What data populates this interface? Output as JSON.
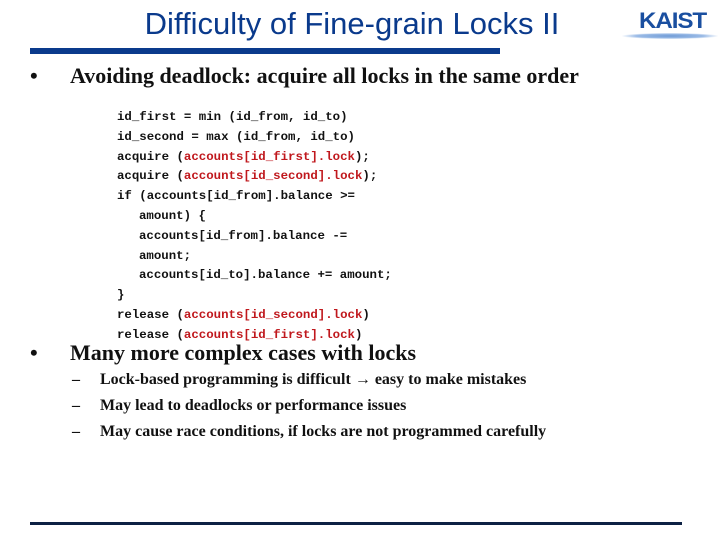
{
  "slide": {
    "title": "Difficulty of Fine-grain Locks II",
    "logo_text": "KAIST",
    "colors": {
      "title": "#0a3a8c",
      "rule": "#0a3a8c",
      "code_highlight": "#c0181d",
      "bottom_rule": "#0d2144"
    },
    "bullets": [
      {
        "marker": "•",
        "text": "Avoiding deadlock: acquire all locks in the same order",
        "code": [
          {
            "indent": false,
            "parts": [
              {
                "t": "id_first = min (id_from, id_to)",
                "hl": false
              }
            ]
          },
          {
            "indent": false,
            "parts": [
              {
                "t": "id_second = max (id_from, id_to)",
                "hl": false
              }
            ]
          },
          {
            "indent": false,
            "parts": [
              {
                "t": "acquire (",
                "hl": false
              },
              {
                "t": "accounts[id_first].lock",
                "hl": true
              },
              {
                "t": ");",
                "hl": false
              }
            ]
          },
          {
            "indent": false,
            "parts": [
              {
                "t": "acquire (",
                "hl": false
              },
              {
                "t": "accounts[id_second].lock",
                "hl": true
              },
              {
                "t": ");",
                "hl": false
              }
            ]
          },
          {
            "indent": false,
            "parts": [
              {
                "t": "if (accounts[id_from].balance >=",
                "hl": false
              }
            ]
          },
          {
            "indent": true,
            "parts": [
              {
                "t": "amount) {",
                "hl": false
              }
            ]
          },
          {
            "indent": true,
            "parts": [
              {
                "t": "accounts[id_from].balance -=",
                "hl": false
              }
            ]
          },
          {
            "indent": true,
            "parts": [
              {
                "t": "amount;",
                "hl": false
              }
            ]
          },
          {
            "indent": true,
            "parts": [
              {
                "t": "accounts[id_to].balance += amount;",
                "hl": false
              }
            ]
          },
          {
            "indent": false,
            "parts": [
              {
                "t": "}",
                "hl": false
              }
            ]
          },
          {
            "indent": false,
            "parts": [
              {
                "t": "release (",
                "hl": false
              },
              {
                "t": "accounts[id_second].lock",
                "hl": true
              },
              {
                "t": ")",
                "hl": false
              }
            ]
          },
          {
            "indent": false,
            "parts": [
              {
                "t": "release (",
                "hl": false
              },
              {
                "t": "accounts[id_first].lock",
                "hl": true
              },
              {
                "t": ")",
                "hl": false
              }
            ]
          }
        ]
      },
      {
        "marker": "•",
        "text": "Many more complex cases with locks",
        "subitems": [
          {
            "marker": "–",
            "text": "Lock-based programming is difficult → easy to make mistakes"
          },
          {
            "marker": "–",
            "text": "May lead to deadlocks or performance issues"
          },
          {
            "marker": "–",
            "text": "May cause race conditions, if locks are not programmed carefully"
          }
        ]
      }
    ]
  }
}
